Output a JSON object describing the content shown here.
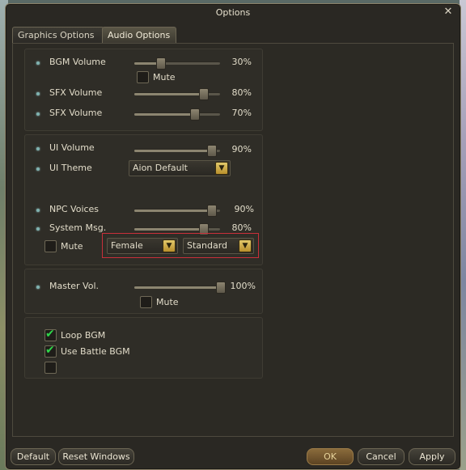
{
  "window": {
    "title": "Options"
  },
  "tabs": [
    {
      "label": "Graphics Options",
      "active": false
    },
    {
      "label": "Audio Options",
      "active": true
    }
  ],
  "group1": {
    "bgm": {
      "label": "BGM Volume",
      "value": "30%",
      "level": 0.3,
      "mute_label": "Mute",
      "mute_checked": false
    },
    "sfx1": {
      "label": "SFX Volume",
      "value": "80%",
      "level": 0.8
    },
    "sfx2": {
      "label": "SFX Volume",
      "value": "70%",
      "level": 0.7
    }
  },
  "group2": {
    "ui_volume": {
      "label": "UI Volume",
      "value": "90%",
      "level": 0.9
    },
    "ui_theme": {
      "label": "UI Theme",
      "selected": "Aion Default"
    },
    "npc_voices": {
      "label": "NPC Voices",
      "value": "90%",
      "level": 0.9
    },
    "system_msg": {
      "label": "System Msg.",
      "value": "80%",
      "level": 0.8
    },
    "mute_label": "Mute",
    "mute_checked": false,
    "voice_gender": {
      "selected": "Female"
    },
    "voice_style": {
      "selected": "Standard"
    }
  },
  "group3": {
    "master": {
      "label": "Master Vol.",
      "value": "100%",
      "level": 1.0,
      "mute_label": "Mute",
      "mute_checked": false
    }
  },
  "group4": {
    "loop_bgm": {
      "label": "Loop BGM",
      "checked": true
    },
    "battle_bgm": {
      "label": "Use Battle BGM",
      "checked": true
    },
    "empty": {
      "label": "",
      "checked": false
    }
  },
  "footer": {
    "default_label": "Default",
    "reset_label": "Reset Windows",
    "ok_label": "OK",
    "cancel_label": "Cancel",
    "apply_label": "Apply"
  },
  "colors": {
    "accent": "#2fd64a",
    "highlight_border": "#c8303a",
    "bullet": "#7fb2b0"
  }
}
